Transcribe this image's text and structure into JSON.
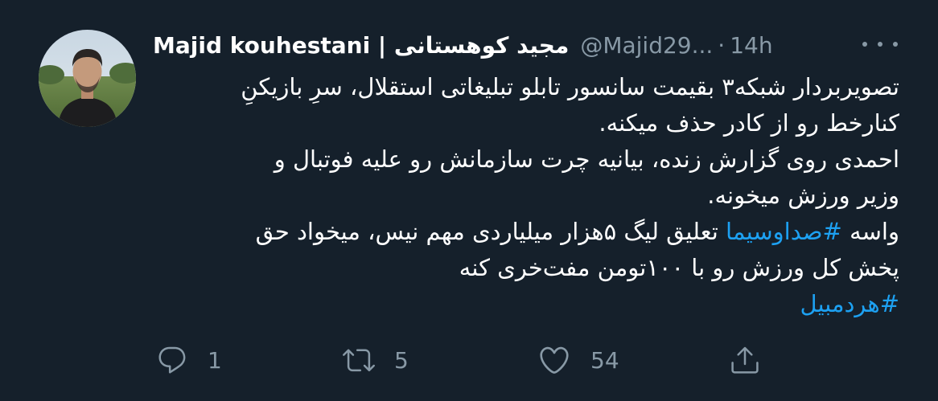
{
  "author": {
    "display_name": "Majid kouhestani | مجید کوهستانی",
    "handle": "@Majid29...",
    "separator": "·",
    "time": "14h"
  },
  "tweet": {
    "lines": [
      "تصویربردار شبکه۳ بقیمت سانسور تابلو تبلیغاتی استقلال، سرِ بازیکنِ",
      "کنارخط رو از کادر حذف میکنه.",
      "احمدی روی گزارش زنده، بیانیه چرت سازمانش رو علیه فوتبال و",
      "وزیر ورزش میخونه."
    ],
    "line5_before": "واسه ",
    "line5_hashtag": "#صداوسیما",
    "line5_after": " تعلیق لیگ ۵هزار میلیاردی مهم نیس، میخواد حق",
    "line6": "پخش کل ورزش رو با ۱۰۰تومن مفت‌خری کنه",
    "hashtag2": "#هردمبیل"
  },
  "actions": {
    "reply_count": "1",
    "retweet_count": "5",
    "like_count": "54"
  },
  "icons": {
    "reply": "reply-icon",
    "retweet": "retweet-icon",
    "like": "like-icon",
    "share": "share-icon",
    "more": "more-icon"
  },
  "colors": {
    "background": "#15202b",
    "text": "#ffffff",
    "secondary": "#8899a6",
    "accent": "#1da1f2"
  }
}
